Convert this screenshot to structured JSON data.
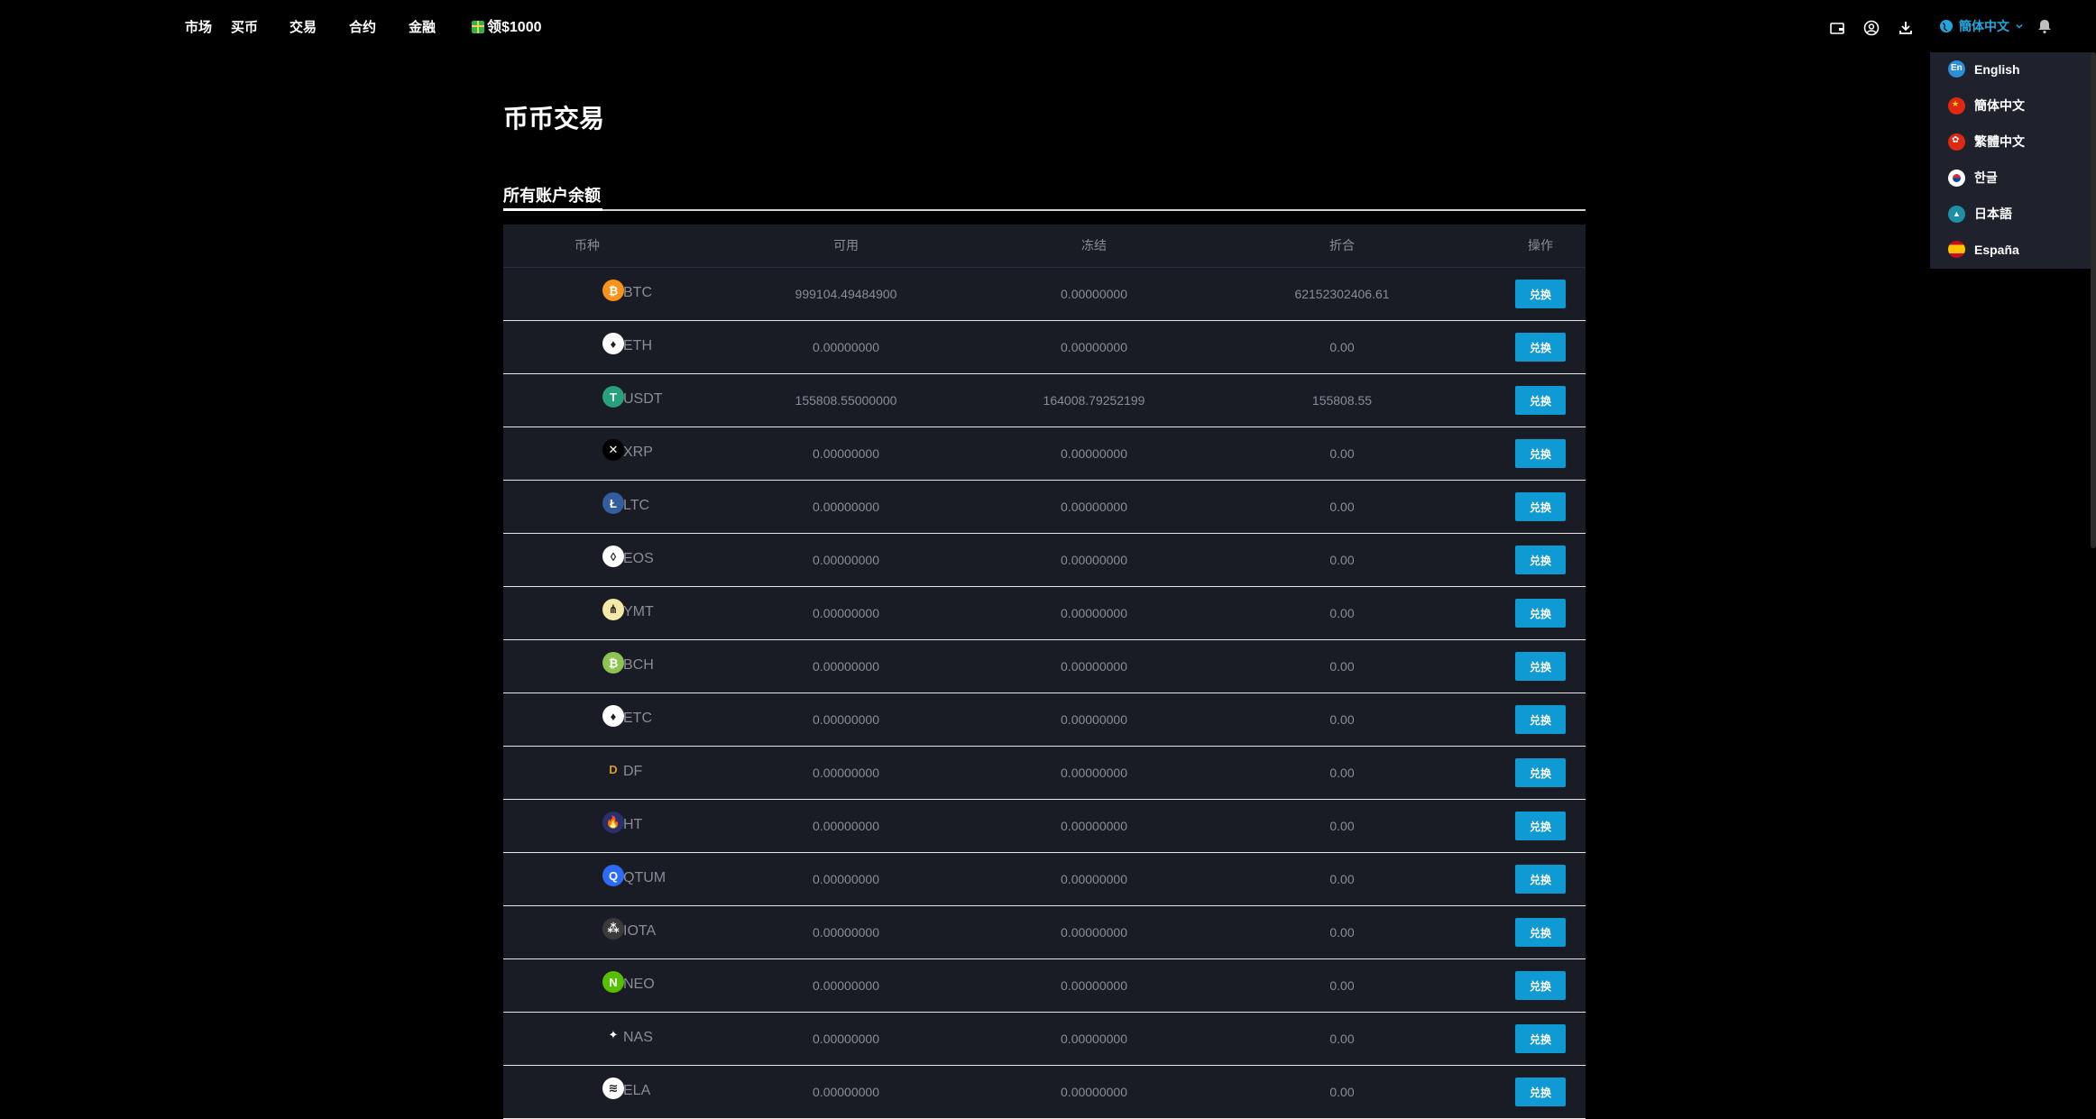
{
  "nav": {
    "items": [
      "市场",
      "买币",
      "交易",
      "合约",
      "金融"
    ],
    "promo": "领$1000",
    "language": "簡体中文"
  },
  "language_menu": {
    "options": [
      {
        "label": "English",
        "icon": "en-flag-icon"
      },
      {
        "label": "簡体中文",
        "icon": "china-flag-icon"
      },
      {
        "label": "繁體中文",
        "icon": "hongkong-flag-icon"
      },
      {
        "label": "한글",
        "icon": "korea-flag-icon"
      },
      {
        "label": "日本語",
        "icon": "japan-flag-icon"
      },
      {
        "label": "España",
        "icon": "spain-flag-icon"
      }
    ]
  },
  "page": {
    "title": "币币交易",
    "tab": "所有账户余额"
  },
  "table": {
    "headers": [
      "币种",
      "可用",
      "冻结",
      "折合",
      "操作"
    ],
    "action_label": "兑换",
    "rows": [
      {
        "coin": "BTC",
        "available": "999104.49484900",
        "frozen": "0.00000000",
        "equiv": "62152302406.61",
        "icon_color": "#f7931a",
        "glyph": "₿"
      },
      {
        "coin": "ETH",
        "available": "0.00000000",
        "frozen": "0.00000000",
        "equiv": "0.00",
        "icon_color": "#ffffff",
        "glyph": "♦"
      },
      {
        "coin": "USDT",
        "available": "155808.55000000",
        "frozen": "164008.79252199",
        "equiv": "155808.55",
        "icon_color": "#26a17b",
        "glyph": "T"
      },
      {
        "coin": "XRP",
        "available": "0.00000000",
        "frozen": "0.00000000",
        "equiv": "0.00",
        "icon_color": "#000000",
        "glyph": "✕"
      },
      {
        "coin": "LTC",
        "available": "0.00000000",
        "frozen": "0.00000000",
        "equiv": "0.00",
        "icon_color": "#345d9d",
        "glyph": "Ł"
      },
      {
        "coin": "EOS",
        "available": "0.00000000",
        "frozen": "0.00000000",
        "equiv": "0.00",
        "icon_color": "#ffffff",
        "glyph": "◊"
      },
      {
        "coin": "YMT",
        "available": "0.00000000",
        "frozen": "0.00000000",
        "equiv": "0.00",
        "icon_color": "#f5e9a8",
        "glyph": "⋔"
      },
      {
        "coin": "BCH",
        "available": "0.00000000",
        "frozen": "0.00000000",
        "equiv": "0.00",
        "icon_color": "#8dc351",
        "glyph": "₿"
      },
      {
        "coin": "ETC",
        "available": "0.00000000",
        "frozen": "0.00000000",
        "equiv": "0.00",
        "icon_color": "#ffffff",
        "glyph": "♦"
      },
      {
        "coin": "DF",
        "available": "0.00000000",
        "frozen": "0.00000000",
        "equiv": "0.00",
        "icon_color": "transparent",
        "glyph": "D"
      },
      {
        "coin": "HT",
        "available": "0.00000000",
        "frozen": "0.00000000",
        "equiv": "0.00",
        "icon_color": "#2a3069",
        "glyph": "🔥"
      },
      {
        "coin": "QTUM",
        "available": "0.00000000",
        "frozen": "0.00000000",
        "equiv": "0.00",
        "icon_color": "#2e6bf5",
        "glyph": "Q"
      },
      {
        "coin": "IOTA",
        "available": "0.00000000",
        "frozen": "0.00000000",
        "equiv": "0.00",
        "icon_color": "#3a3a3a",
        "glyph": "⁂"
      },
      {
        "coin": "NEO",
        "available": "0.00000000",
        "frozen": "0.00000000",
        "equiv": "0.00",
        "icon_color": "#58bf00",
        "glyph": "N"
      },
      {
        "coin": "NAS",
        "available": "0.00000000",
        "frozen": "0.00000000",
        "equiv": "0.00",
        "icon_color": "transparent",
        "glyph": "✦"
      },
      {
        "coin": "ELA",
        "available": "0.00000000",
        "frozen": "0.00000000",
        "equiv": "0.00",
        "icon_color": "#ffffff",
        "glyph": "≋"
      }
    ]
  },
  "colors": {
    "accent": "#0f9ad3",
    "background": "#000000",
    "table_bg": "#191b25",
    "menu_bg": "#1f222d"
  }
}
